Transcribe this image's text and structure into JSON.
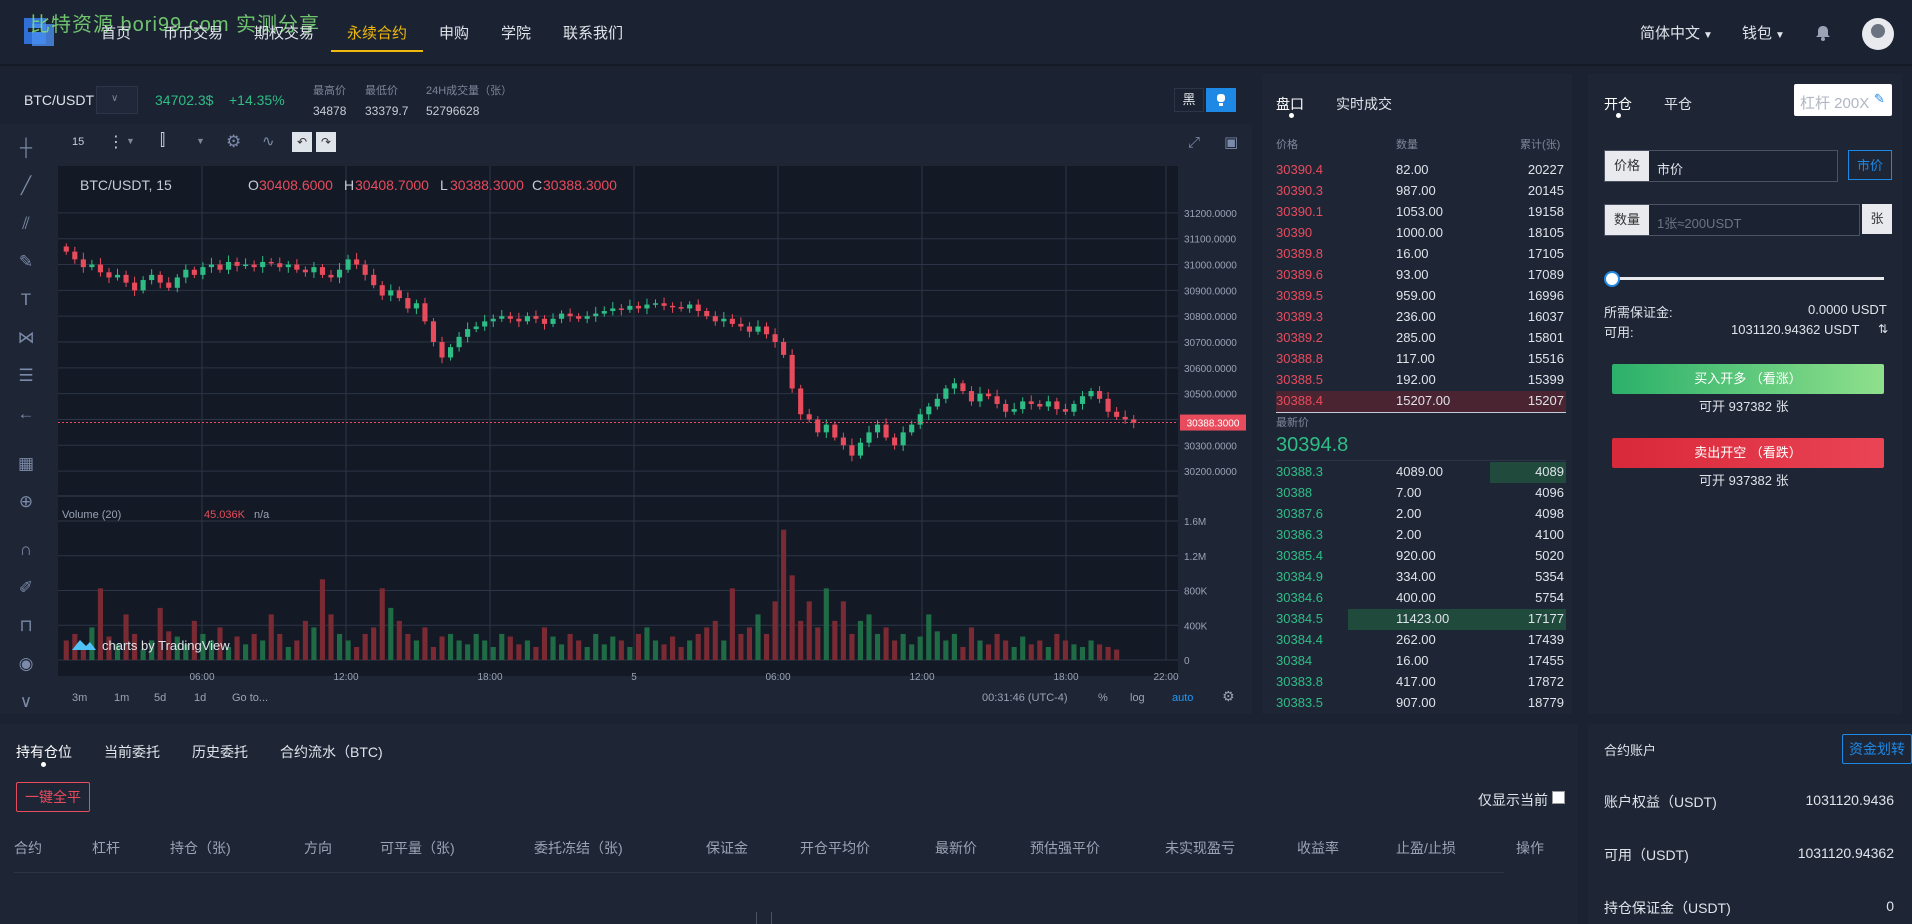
{
  "watermark": "比特资源 bori99.com 实测分享",
  "nav": {
    "items": [
      "首页",
      "币币交易",
      "期权交易",
      "永续合约",
      "申购",
      "学院",
      "联系我们"
    ],
    "active_index": 3,
    "language": "简体中文",
    "wallet": "钱包"
  },
  "ticker": {
    "symbol": "BTC/USDT",
    "last_price": "34702.3$",
    "change": "+14.35%",
    "labels": [
      "最高价",
      "最低价",
      "24H成交量（张）"
    ],
    "values": [
      "34878",
      "33379.7",
      "52796628"
    ],
    "theme_label": "黑"
  },
  "chart": {
    "interval": "15",
    "legend_symbol": "BTC/USDT, 15",
    "ohlc": {
      "o_label": "O",
      "o": "30408.6000",
      "h_label": "H",
      "h": "30408.7000",
      "l_label": "L",
      "l": "30388.3000",
      "c_label": "C",
      "c": "30388.3000"
    },
    "current_price_tag": "30388.3000",
    "volume_label": "Volume (20)",
    "volume_value": "45.036K",
    "volume_na": "n/a",
    "brand": "charts by TradingView",
    "y_ticks": [
      "31200.0000",
      "31100.0000",
      "31000.0000",
      "30900.0000",
      "30800.0000",
      "30700.0000",
      "30600.0000",
      "30500.0000",
      "30400.0000",
      "30300.0000",
      "30200.0000"
    ],
    "vol_ticks": [
      "1.6M",
      "1.2M",
      "800K",
      "400K",
      "0"
    ],
    "x_ticks": [
      "06:00",
      "12:00",
      "18:00",
      "5",
      "06:00",
      "12:00",
      "18:00",
      "22:00"
    ],
    "ranges": [
      "3m",
      "1m",
      "5d",
      "1d",
      "Go to..."
    ],
    "time": "00:31:46 (UTC-4)",
    "opts": [
      "%",
      "log",
      "auto"
    ],
    "accent_up": "#2ebd85",
    "accent_down": "#e84b5c"
  },
  "chart_data": {
    "type": "candlestick",
    "title": "BTC/USDT, 15",
    "ylim": [
      30150,
      31250
    ],
    "closes": [
      31050,
      31020,
      30990,
      31000,
      30970,
      30950,
      30960,
      30930,
      30900,
      30940,
      30960,
      30930,
      30910,
      30950,
      30980,
      30960,
      30990,
      31000,
      30980,
      31010,
      30995,
      31000,
      30990,
      31010,
      31005,
      30990,
      31000,
      30980,
      30970,
      30990,
      30960,
      30950,
      30980,
      31020,
      31000,
      30960,
      30920,
      30880,
      30900,
      30870,
      30830,
      30850,
      30780,
      30700,
      30640,
      30680,
      30720,
      30750,
      30760,
      30780,
      30790,
      30800,
      30790,
      30780,
      30800,
      30790,
      30770,
      30790,
      30810,
      30800,
      30790,
      30800,
      30810,
      30820,
      30830,
      30825,
      30840,
      30830,
      30845,
      30850,
      30840,
      30835,
      30830,
      30845,
      30820,
      30800,
      30780,
      30790,
      30770,
      30760,
      30740,
      30760,
      30730,
      30700,
      30650,
      30520,
      30420,
      30400,
      30350,
      30380,
      30330,
      30300,
      30260,
      30310,
      30350,
      30380,
      30330,
      30300,
      30350,
      30380,
      30420,
      30450,
      30480,
      30520,
      30540,
      30510,
      30470,
      30500,
      30490,
      30460,
      30430,
      30440,
      30470,
      30460,
      30450,
      30470,
      30440,
      30430,
      30460,
      30490,
      30510,
      30480,
      30430,
      30410,
      30400,
      30388
    ],
    "volumes": [
      0.15,
      0.2,
      0.1,
      0.25,
      0.55,
      0.18,
      0.12,
      0.35,
      0.2,
      0.08,
      0.15,
      0.4,
      0.22,
      0.18,
      0.12,
      0.3,
      0.2,
      0.15,
      0.25,
      0.1,
      0.18,
      0.12,
      0.2,
      0.15,
      0.35,
      0.2,
      0.1,
      0.15,
      0.3,
      0.25,
      0.62,
      0.35,
      0.2,
      0.15,
      0.1,
      0.2,
      0.25,
      0.55,
      0.4,
      0.3,
      0.2,
      0.15,
      0.25,
      0.1,
      0.18,
      0.2,
      0.15,
      0.12,
      0.2,
      0.15,
      0.1,
      0.2,
      0.18,
      0.12,
      0.15,
      0.1,
      0.25,
      0.18,
      0.12,
      0.2,
      0.15,
      0.1,
      0.2,
      0.12,
      0.18,
      0.15,
      0.1,
      0.2,
      0.25,
      0.15,
      0.12,
      0.18,
      0.1,
      0.15,
      0.2,
      0.25,
      0.3,
      0.15,
      0.55,
      0.2,
      0.25,
      0.35,
      0.2,
      0.45,
      1.0,
      0.65,
      0.3,
      0.45,
      0.25,
      0.55,
      0.3,
      0.45,
      0.2,
      0.3,
      0.35,
      0.2,
      0.25,
      0.15,
      0.2,
      0.12,
      0.18,
      0.35,
      0.22,
      0.15,
      0.2,
      0.1,
      0.25,
      0.15,
      0.12,
      0.2,
      0.15,
      0.1,
      0.18,
      0.12,
      0.15,
      0.1,
      0.2,
      0.15,
      0.12,
      0.1,
      0.15,
      0.12,
      0.1,
      0.08
    ]
  },
  "book": {
    "tabs": [
      "盘口",
      "实时成交"
    ],
    "headers": [
      "价格",
      "数量",
      "累计(张)"
    ],
    "asks": [
      [
        "30390.4",
        "82.00",
        "20227"
      ],
      [
        "30390.3",
        "987.00",
        "20145"
      ],
      [
        "30390.1",
        "1053.00",
        "19158"
      ],
      [
        "30390",
        "1000.00",
        "18105"
      ],
      [
        "30389.8",
        "16.00",
        "17105"
      ],
      [
        "30389.6",
        "93.00",
        "17089"
      ],
      [
        "30389.5",
        "959.00",
        "16996"
      ],
      [
        "30389.3",
        "236.00",
        "16037"
      ],
      [
        "30389.2",
        "285.00",
        "15801"
      ],
      [
        "30388.8",
        "117.00",
        "15516"
      ],
      [
        "30388.5",
        "192.00",
        "15399"
      ],
      [
        "30388.4",
        "15207.00",
        "15207"
      ]
    ],
    "last_label": "最新价",
    "last_price": "30394.8",
    "bids": [
      [
        "30388.3",
        "4089.00",
        "4089"
      ],
      [
        "30388",
        "7.00",
        "4096"
      ],
      [
        "30387.6",
        "2.00",
        "4098"
      ],
      [
        "30386.3",
        "2.00",
        "4100"
      ],
      [
        "30385.4",
        "920.00",
        "5020"
      ],
      [
        "30384.9",
        "334.00",
        "5354"
      ],
      [
        "30384.6",
        "400.00",
        "5754"
      ],
      [
        "30384.5",
        "11423.00",
        "17177"
      ],
      [
        "30384.4",
        "262.00",
        "17439"
      ],
      [
        "30384",
        "16.00",
        "17455"
      ],
      [
        "30383.8",
        "417.00",
        "17872"
      ],
      [
        "30383.5",
        "907.00",
        "18779"
      ]
    ]
  },
  "trade": {
    "tabs": [
      "开仓",
      "平仓"
    ],
    "leverage_placeholder": "杠杆 200X",
    "price_label": "价格",
    "price_value": "市价",
    "market_btn": "市价",
    "qty_label": "数量",
    "qty_placeholder": "1张≈200USDT",
    "qty_unit": "张",
    "margin_label": "所需保证金:",
    "margin_value": "0.0000 USDT",
    "avail_label": "可用:",
    "avail_value": "1031120.94362 USDT",
    "buy_label": "买入开多 （看涨）",
    "buy_sub": "可开 937382 张",
    "sell_label": "卖出开空 （看跌）",
    "sell_sub": "可开 937382 张"
  },
  "positions": {
    "tabs": [
      "持有仓位",
      "当前委托",
      "历史委托",
      "合约流水（BTC)"
    ],
    "close_all": "一键全平",
    "only_current": "仅显示当前",
    "columns": [
      "合约",
      "杠杆",
      "持仓（张)",
      "方向",
      "可平量（张)",
      "委托冻结（张)",
      "保证金",
      "开仓平均价",
      "最新价",
      "预估强平价",
      "未实现盈亏",
      "收益率",
      "止盈/止损",
      "操作"
    ]
  },
  "account": {
    "title": "合约账户",
    "transfer": "资金划转",
    "rows": [
      [
        "账户权益（USDT)",
        "1031120.9436"
      ],
      [
        "可用（USDT)",
        "1031120.94362"
      ],
      [
        "持仓保证金（USDT)",
        "0"
      ]
    ]
  }
}
